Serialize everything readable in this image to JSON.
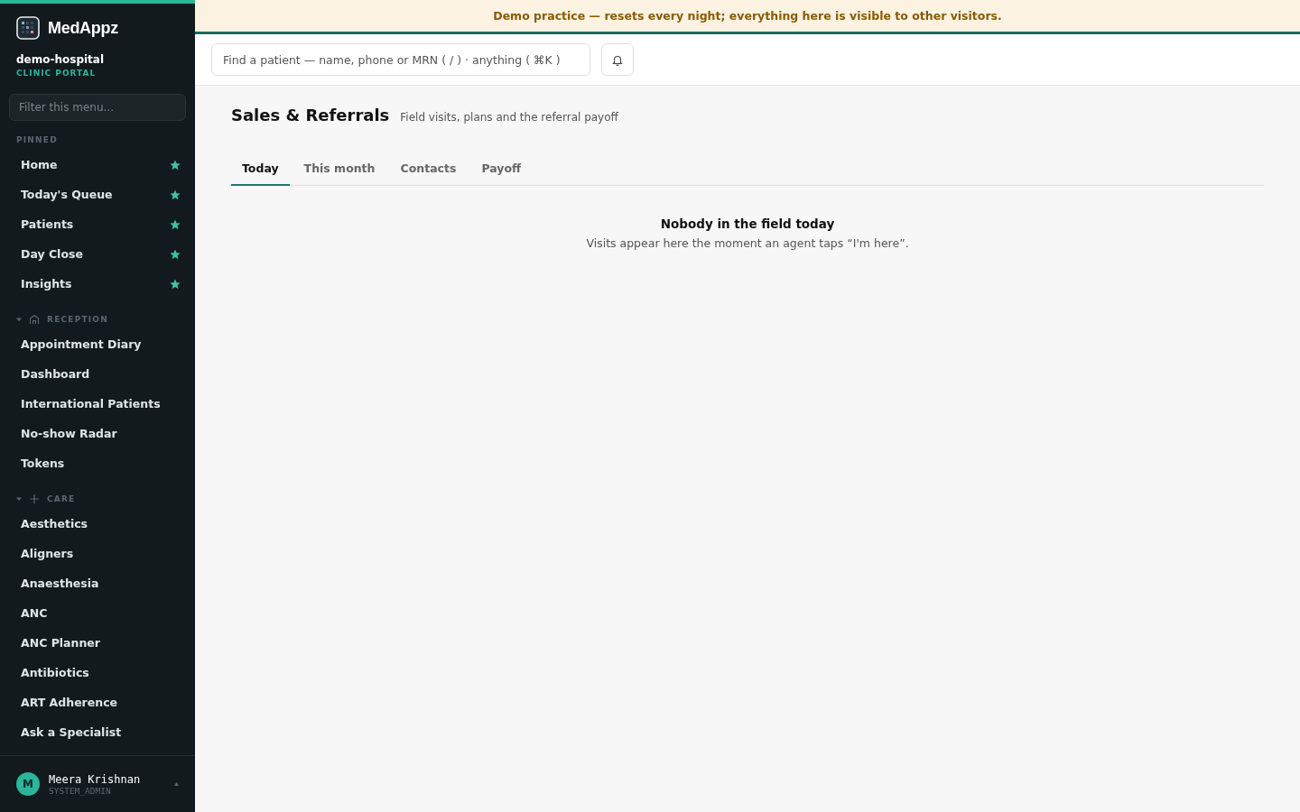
{
  "sidebar": {
    "brand": "MedAppz",
    "org": "demo-hospital",
    "portal": "CLINIC PORTAL",
    "filter": {
      "placeholder": "Filter this menu..."
    },
    "pinned": {
      "title": "PINNED",
      "items": [
        {
          "label": "Home",
          "starred": true
        },
        {
          "label": "Today's Queue",
          "starred": true
        },
        {
          "label": "Patients",
          "starred": true
        },
        {
          "label": "Day Close",
          "starred": true
        },
        {
          "label": "Insights",
          "starred": true
        }
      ]
    },
    "groups": [
      {
        "title": "RECEPTION",
        "kind": "house",
        "expanded": true,
        "items": [
          "Appointment Diary",
          "Dashboard",
          "International Patients",
          "No-show Radar",
          "Tokens"
        ]
      },
      {
        "title": "CARE",
        "kind": "plus",
        "expanded": true,
        "items": [
          "Aesthetics",
          "Aligners",
          "Anaesthesia",
          "ANC",
          "ANC Planner",
          "Antibiotics",
          "ART Adherence",
          "Ask a Specialist"
        ]
      }
    ],
    "user": {
      "initial": "M",
      "name": "Meera Krishnan",
      "role": "SYSTEM_ADMIN"
    }
  },
  "banner": "Demo practice — resets every night; everything here is visible to other visitors.",
  "search": {
    "placeholder": "Find a patient — name, phone or MRN ( / ) · anything ( ⌘K )"
  },
  "page": {
    "title": "Sales & Referrals",
    "subtitle": "Field visits, plans and the referral payoff",
    "tabs": [
      {
        "label": "Today",
        "selected": true
      },
      {
        "label": "This month",
        "selected": false
      },
      {
        "label": "Contacts",
        "selected": false
      },
      {
        "label": "Payoff",
        "selected": false
      }
    ],
    "empty": {
      "title": "Nobody in the field today",
      "text": "Visits appear here the moment an agent taps “I'm here”."
    }
  }
}
